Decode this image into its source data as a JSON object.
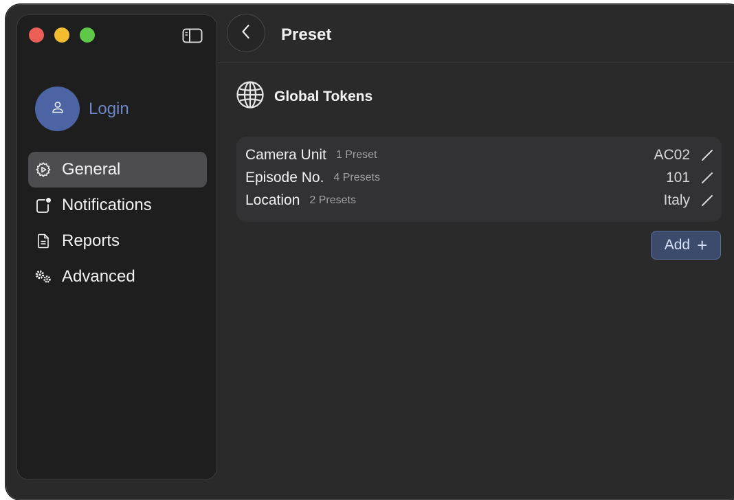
{
  "header": {
    "title": "Preset"
  },
  "sidebar": {
    "login_label": "Login",
    "items": [
      {
        "label": "General",
        "icon": "gear-icon",
        "active": true
      },
      {
        "label": "Notifications",
        "icon": "notification-badge-icon",
        "active": false
      },
      {
        "label": "Reports",
        "icon": "document-icon",
        "active": false
      },
      {
        "label": "Advanced",
        "icon": "gears-icon",
        "active": false
      }
    ]
  },
  "section": {
    "title": "Global Tokens",
    "icon": "globe-icon"
  },
  "tokens": [
    {
      "name": "Camera Unit",
      "count": "1 Preset",
      "value": "AC02"
    },
    {
      "name": "Episode No.",
      "count": "4 Presets",
      "value": "101"
    },
    {
      "name": "Location",
      "count": "2 Presets",
      "value": "Italy"
    }
  ],
  "actions": {
    "add_label": "Add",
    "add_icon": "plus-icon"
  },
  "colors": {
    "accent": "#4c64a3",
    "login_text": "#6f86c6",
    "traffic_red": "#ec5f57",
    "traffic_yellow": "#f4bd30",
    "traffic_green": "#5ec848"
  }
}
